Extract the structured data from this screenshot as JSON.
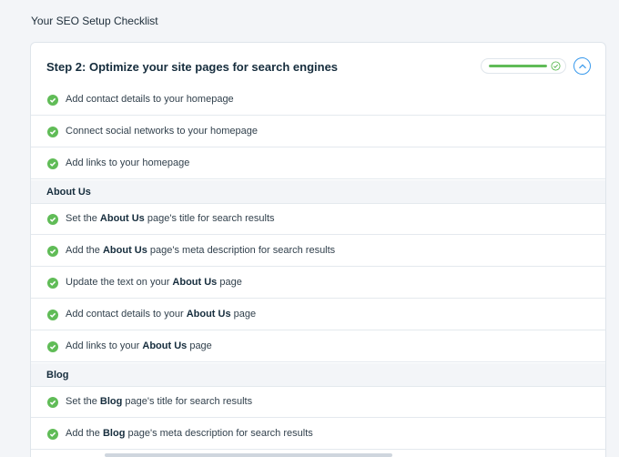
{
  "page": {
    "title": "Your SEO Setup Checklist"
  },
  "step": {
    "title": "Step 2: Optimize your site pages for search engines",
    "progress_fraction": 1.0,
    "collapse_icon": "chevron-up-icon"
  },
  "colors": {
    "accent": "#3899ec",
    "success": "#60bc57"
  },
  "home_tasks": [
    {
      "pre": "Add contact details to your homepage",
      "bold": "",
      "post": ""
    },
    {
      "pre": "Connect social networks to your homepage",
      "bold": "",
      "post": ""
    },
    {
      "pre": "Add links to your homepage",
      "bold": "",
      "post": ""
    }
  ],
  "sections": [
    {
      "title": "About Us",
      "tasks": [
        {
          "pre": "Set the ",
          "bold": "About Us",
          "post": " page's title for search results"
        },
        {
          "pre": "Add the ",
          "bold": "About Us",
          "post": " page's meta description for search results"
        },
        {
          "pre": "Update the text on your ",
          "bold": "About Us",
          "post": " page"
        },
        {
          "pre": "Add contact details to your ",
          "bold": "About Us",
          "post": " page"
        },
        {
          "pre": "Add links to your ",
          "bold": "About Us",
          "post": " page"
        }
      ]
    },
    {
      "title": "Blog",
      "tasks": [
        {
          "pre": "Set the ",
          "bold": "Blog",
          "post": " page's title for search results"
        },
        {
          "pre": "Add the ",
          "bold": "Blog",
          "post": " page's meta description for search results"
        }
      ]
    }
  ]
}
